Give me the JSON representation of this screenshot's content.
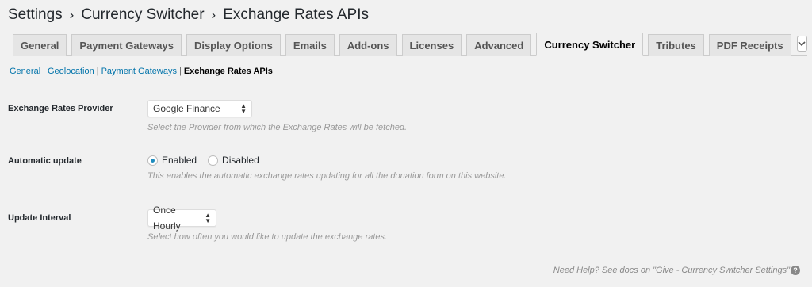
{
  "breadcrumb": [
    "Settings",
    "Currency Switcher",
    "Exchange Rates APIs"
  ],
  "tabs": [
    {
      "label": "General"
    },
    {
      "label": "Payment Gateways"
    },
    {
      "label": "Display Options"
    },
    {
      "label": "Emails"
    },
    {
      "label": "Add-ons"
    },
    {
      "label": "Licenses"
    },
    {
      "label": "Advanced"
    },
    {
      "label": "Currency Switcher"
    },
    {
      "label": "Tributes"
    },
    {
      "label": "PDF Receipts"
    }
  ],
  "subnav": {
    "general": "General",
    "geolocation": "Geolocation",
    "payment_gateways": "Payment Gateways",
    "current": "Exchange Rates APIs"
  },
  "provider": {
    "label": "Exchange Rates Provider",
    "value": "Google Finance",
    "description": "Select the Provider from which the Exchange Rates will be fetched."
  },
  "auto_update": {
    "label": "Automatic update",
    "enabled": "Enabled",
    "disabled": "Disabled",
    "description": "This enables the automatic exchange rates updating for all the donation form on this website."
  },
  "interval": {
    "label": "Update Interval",
    "value": "Once Hourly",
    "description": "Select how often you would like to update the exchange rates."
  },
  "help": "Need Help? See docs on \"Give - Currency Switcher Settings\"",
  "colors": {
    "accent": "#1e8cbe",
    "link": "#0073aa"
  }
}
